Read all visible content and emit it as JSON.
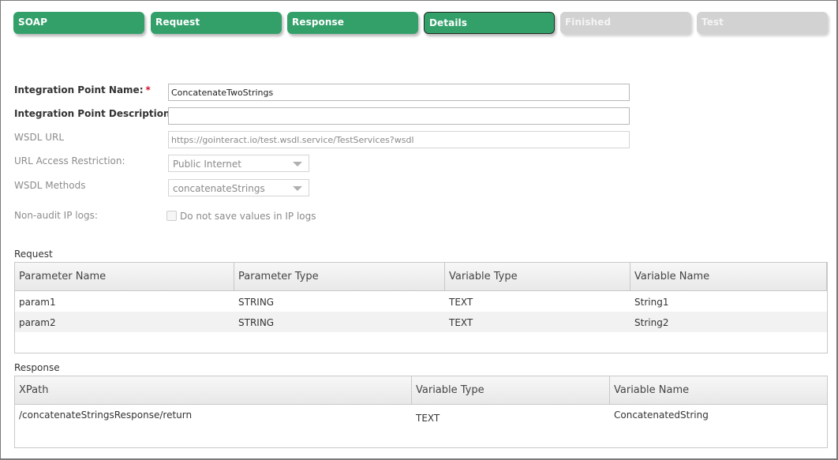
{
  "steps": [
    {
      "label": "SOAP",
      "state": "done"
    },
    {
      "label": "Request",
      "state": "done"
    },
    {
      "label": "Response",
      "state": "done"
    },
    {
      "label": "Details",
      "state": "active"
    },
    {
      "label": "Finished",
      "state": "todo"
    },
    {
      "label": "Test",
      "state": "todo"
    }
  ],
  "colors": {
    "step_done": "#33a06a",
    "step_todo": "#d2d2d2",
    "required": "#d0142c"
  },
  "form": {
    "name_label": "Integration Point Name:",
    "required_mark": "*",
    "name_value": "ConcatenateTwoStrings",
    "description_label": "Integration Point Description:",
    "description_value": "",
    "wsdl_url_label": "WSDL URL",
    "wsdl_url_value": "https://gointeract.io/test.wsdl.service/TestServices?wsdl",
    "access_label": "URL Access Restriction:",
    "access_value": "Public Internet",
    "methods_label": "WSDL Methods",
    "methods_value": "concatenateStrings",
    "ip_logs_label": "Non-audit IP logs:",
    "ip_logs_checkbox_label": "Do not save values in IP logs",
    "ip_logs_checked": false
  },
  "request": {
    "title": "Request",
    "columns": [
      "Parameter Name",
      "Parameter Type",
      "Variable Type",
      "Variable Name"
    ],
    "rows": [
      [
        "param1",
        "STRING",
        "TEXT",
        "String1"
      ],
      [
        "param2",
        "STRING",
        "TEXT",
        "String2"
      ]
    ]
  },
  "response": {
    "title": "Response",
    "columns": [
      "XPath",
      "Variable Type",
      "Variable Name"
    ],
    "rows": [
      [
        "/concatenateStringsResponse/return",
        "TEXT",
        "ConcatenatedString"
      ]
    ]
  }
}
